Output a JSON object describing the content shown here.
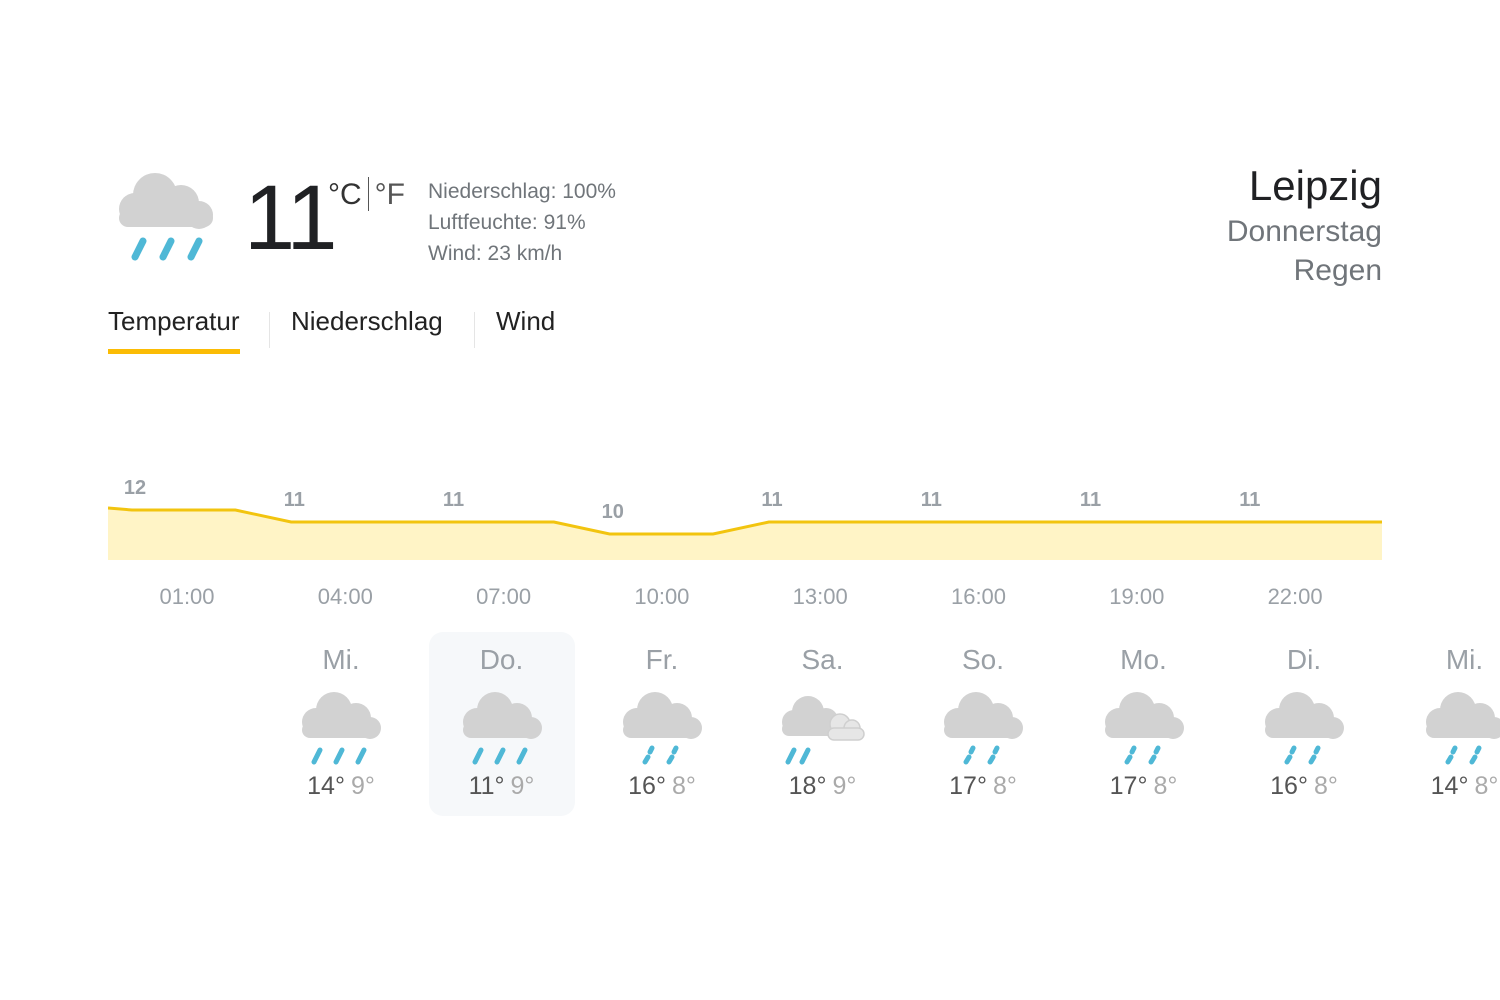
{
  "current": {
    "icon": "rain-icon",
    "temperature": "11",
    "unit_c": "°C",
    "unit_f": "°F",
    "precipitation": "Niederschlag: 100%",
    "humidity": "Luftfeuchte: 91%",
    "wind": "Wind: 23 km/h"
  },
  "location": {
    "city": "Leipzig",
    "weekday": "Donnerstag",
    "condition": "Regen"
  },
  "tabs": [
    {
      "label": "Temperatur",
      "active": true
    },
    {
      "label": "Niederschlag",
      "active": false
    },
    {
      "label": "Wind",
      "active": false
    }
  ],
  "colors": {
    "accent": "#fbbc04",
    "line": "#f2c40f",
    "fill": "#fff4c6",
    "rain": "#4fb8d6",
    "cloud": "#d2d2d2"
  },
  "chart_data": {
    "type": "area",
    "x": [
      "01:00",
      "04:00",
      "07:00",
      "10:00",
      "13:00",
      "16:00",
      "19:00",
      "22:00"
    ],
    "values": [
      12,
      11,
      11,
      10,
      11,
      11,
      11,
      11
    ],
    "labels": [
      "12",
      "11",
      "11",
      "10",
      "11",
      "11",
      "11",
      "11"
    ]
  },
  "forecast": [
    {
      "day": "Mi.",
      "high": "14°",
      "low": "9°",
      "icon": "heavy-rain-icon",
      "selected": false
    },
    {
      "day": "Do.",
      "high": "11°",
      "low": "9°",
      "icon": "heavy-rain-icon",
      "selected": true
    },
    {
      "day": "Fr.",
      "high": "16°",
      "low": "8°",
      "icon": "light-rain-icon",
      "selected": false
    },
    {
      "day": "Sa.",
      "high": "18°",
      "low": "9°",
      "icon": "cloudy-rain-icon",
      "selected": false
    },
    {
      "day": "So.",
      "high": "17°",
      "low": "8°",
      "icon": "light-rain-icon",
      "selected": false
    },
    {
      "day": "Mo.",
      "high": "17°",
      "low": "8°",
      "icon": "light-rain-icon",
      "selected": false
    },
    {
      "day": "Di.",
      "high": "16°",
      "low": "8°",
      "icon": "light-rain-icon",
      "selected": false
    },
    {
      "day": "Mi.",
      "high": "14°",
      "low": "8°",
      "icon": "light-rain-icon",
      "selected": false
    }
  ]
}
